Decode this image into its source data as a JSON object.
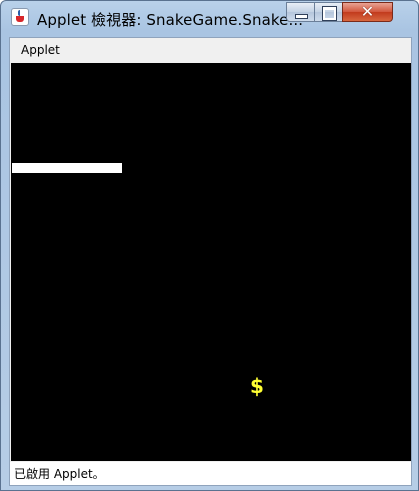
{
  "window": {
    "title": "Applet 檢視器: SnakeGame.Snake...",
    "controls": {
      "minimize_icon": "minimize-icon",
      "maximize_icon": "maximize-icon",
      "close_icon": "close-icon",
      "close_glyph": "✕"
    },
    "app_icon": "java-cup-icon"
  },
  "menubar": {
    "items": [
      {
        "label": "Applet"
      }
    ]
  },
  "game": {
    "background": "#000000",
    "snake_color": "#ffffff",
    "food_symbol": "$",
    "food_color": "#ffff33"
  },
  "statusbar": {
    "text": "已啟用 Applet。"
  }
}
